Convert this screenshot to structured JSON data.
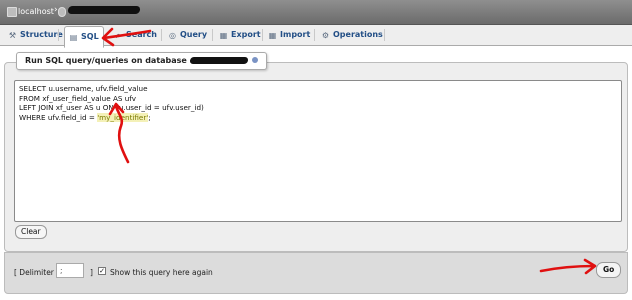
{
  "breadcrumb": {
    "server": "localhost",
    "separator": "›"
  },
  "tabs": [
    {
      "label": "Structure",
      "icon": "structure-icon"
    },
    {
      "label": "SQL",
      "icon": "sql-icon",
      "active": true
    },
    {
      "label": "Search",
      "icon": "search-icon"
    },
    {
      "label": "Query",
      "icon": "query-icon"
    },
    {
      "label": "Export",
      "icon": "export-icon"
    },
    {
      "label": "Import",
      "icon": "import-icon"
    },
    {
      "label": "Operations",
      "icon": "operations-icon"
    }
  ],
  "panel": {
    "legend": "Run SQL query/queries on database"
  },
  "sql": {
    "line1": "SELECT u.username, ufv.field_value",
    "line2": "FROM xf_user_field_value AS ufv",
    "line3": "LEFT JOIN xf_user AS u ON (u.user_id = ufv.user_id)",
    "line4_prefix": "WHERE ufv.field_id = ",
    "line4_string": "'my_identifier'",
    "line4_suffix": ";"
  },
  "buttons": {
    "clear": "Clear",
    "go": "Go"
  },
  "footer": {
    "delimiter_label": "[ Delimiter",
    "delimiter_value": ";",
    "delimiter_close": "]",
    "show_query_label": "Show this query here again",
    "show_query_checked": true
  },
  "colors": {
    "annotation": "#e01010",
    "tab_text": "#234f86"
  }
}
